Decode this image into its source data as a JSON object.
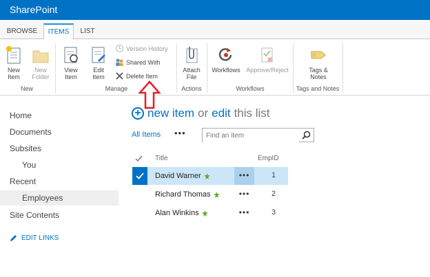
{
  "app": {
    "title": "SharePoint"
  },
  "tabs": [
    {
      "label": "BROWSE",
      "active": false
    },
    {
      "label": "ITEMS",
      "active": true
    },
    {
      "label": "LIST",
      "active": false
    }
  ],
  "ribbon": {
    "new_item": "New Item",
    "new_folder": "New Folder",
    "view_item": "View Item",
    "edit_item": "Edit Item",
    "version_history": "Version History",
    "shared_with": "Shared With",
    "delete_item": "Delete Item",
    "attach_file": "Attach File",
    "workflows": "Workflows",
    "approve_reject": "Approve/Reject",
    "tags_notes": "Tags & Notes",
    "groups": {
      "new": "New",
      "manage": "Manage",
      "actions": "Actions",
      "workflows": "Workflows",
      "tags_notes": "Tags and Notes"
    }
  },
  "leftnav": {
    "items": [
      "Home",
      "Documents",
      "Subsites",
      "You",
      "Recent",
      "Employees",
      "Site Contents"
    ],
    "edit_links": "EDIT LINKS"
  },
  "main": {
    "new_item_prefix": "new item",
    "or_text": "or",
    "edit_text": "edit",
    "this_list": "this list",
    "view_label": "All Items",
    "view_more": "•••",
    "search_placeholder": "Find an item",
    "columns": {
      "title": "Title",
      "empid": "EmpID"
    },
    "rows": [
      {
        "title": "David Warner",
        "empid": "1",
        "selected": true
      },
      {
        "title": "Richard Thomas",
        "empid": "2",
        "selected": false
      },
      {
        "title": "Alan Winkins",
        "empid": "3",
        "selected": false
      }
    ],
    "row_menu": "•••"
  },
  "colors": {
    "brand": "#0072c6",
    "new_badge": "#5aa82a",
    "arrow": "#e21f26"
  },
  "icons": [
    "search-icon",
    "pencil-icon",
    "plus-circle-icon",
    "new-badge-icon",
    "up-arrow-icon"
  ]
}
